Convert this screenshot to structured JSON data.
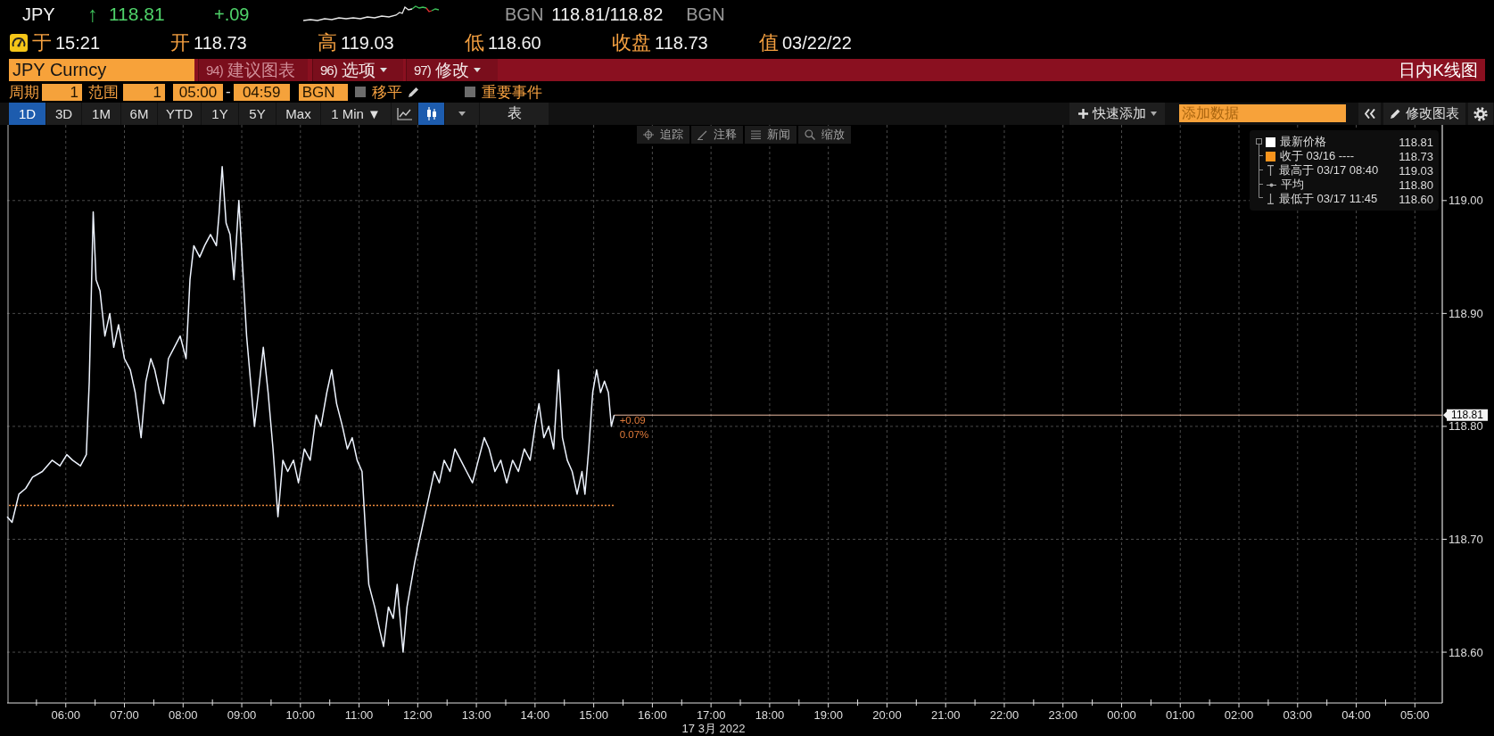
{
  "quote": {
    "ticker": "JPY",
    "arrow": "↑",
    "last": "118.81",
    "change": "+.09",
    "source": "BGN",
    "bid_ask": "118.81/118.82",
    "source_right": "BGN"
  },
  "stats": [
    {
      "label": "于",
      "value": "15:21"
    },
    {
      "label": "开",
      "value": "118.73"
    },
    {
      "label": "高",
      "value": "119.03"
    },
    {
      "label": "低",
      "value": "118.60"
    },
    {
      "label": "收盘",
      "value": "118.73"
    },
    {
      "label": "值",
      "value": "03/22/22"
    }
  ],
  "title_bar": {
    "security": "JPY Curncy",
    "menus": [
      {
        "number": "94)",
        "label": "建议图表",
        "disabled": true,
        "dropdown": false
      },
      {
        "number": "96)",
        "label": "选项",
        "disabled": false,
        "dropdown": true
      },
      {
        "number": "97)",
        "label": "修改",
        "disabled": false,
        "dropdown": true
      }
    ],
    "view_title": "日内K线图"
  },
  "settings": {
    "period_label": "周期",
    "period": "1",
    "range_label": "范围",
    "range": "1",
    "start": "05:00",
    "separator": "-",
    "end": "04:59",
    "source": "BGN",
    "checks": [
      {
        "label": "移平",
        "checked": false,
        "editable": true
      },
      {
        "label": "重要事件",
        "checked": false,
        "editable": false
      }
    ]
  },
  "toolbar": {
    "ranges": [
      {
        "label": "1D",
        "selected": true
      },
      {
        "label": "3D",
        "selected": false
      },
      {
        "label": "1M",
        "selected": false
      },
      {
        "label": "6M",
        "selected": false
      },
      {
        "label": "YTD",
        "selected": false
      },
      {
        "label": "1Y",
        "selected": false
      },
      {
        "label": "5Y",
        "selected": false
      },
      {
        "label": "Max",
        "selected": false
      }
    ],
    "interval": "1 Min ▼",
    "chart_types": [
      {
        "kind": "line",
        "selected": false
      },
      {
        "kind": "bar",
        "selected": true
      }
    ],
    "table": "表",
    "quick_add": "快速添加",
    "data_field": {
      "placeholder": "添加数据"
    },
    "edit_chart": "修改图表"
  },
  "chart": {
    "tools": [
      {
        "kind": "crosshair",
        "label": "追踪"
      },
      {
        "kind": "annotate",
        "label": "注释"
      },
      {
        "kind": "news",
        "label": "新闻"
      },
      {
        "kind": "zoom",
        "label": "缩放"
      }
    ],
    "legend": [
      {
        "kind": "swatch",
        "color": "#ffffff",
        "label": "最新价格",
        "value": "118.81"
      },
      {
        "kind": "swatch",
        "color": "#f7941d",
        "label": "收于 03/16 ----",
        "value": "118.73"
      },
      {
        "kind": "high",
        "label": "最高于 03/17 08:40",
        "value": "119.03"
      },
      {
        "kind": "average",
        "label": "平均",
        "value": "118.80"
      },
      {
        "kind": "low",
        "label": "最低于 03/17 11:45",
        "value": "118.60"
      }
    ],
    "chart_data": {
      "type": "line",
      "xlabel": "17 3月 2022",
      "grid": true,
      "x": [
        "2022-03-17T05:00",
        "2022-03-17T05:05",
        "2022-03-17T05:12",
        "2022-03-17T05:19",
        "2022-03-17T05:26",
        "2022-03-17T05:36",
        "2022-03-17T05:46",
        "2022-03-17T05:54",
        "2022-03-17T06:01",
        "2022-03-17T06:07",
        "2022-03-17T06:15",
        "2022-03-17T06:21",
        "2022-03-17T06:24",
        "2022-03-17T06:28",
        "2022-03-17T06:31",
        "2022-03-17T06:35",
        "2022-03-17T06:40",
        "2022-03-17T06:45",
        "2022-03-17T06:49",
        "2022-03-17T06:54",
        "2022-03-17T07:00",
        "2022-03-17T07:06",
        "2022-03-17T07:11",
        "2022-03-17T07:17",
        "2022-03-17T07:22",
        "2022-03-17T07:27",
        "2022-03-17T07:31",
        "2022-03-17T07:36",
        "2022-03-17T07:40",
        "2022-03-17T07:45",
        "2022-03-17T07:51",
        "2022-03-17T07:57",
        "2022-03-17T08:03",
        "2022-03-17T08:07",
        "2022-03-17T08:11",
        "2022-03-17T08:17",
        "2022-03-17T08:22",
        "2022-03-17T08:28",
        "2022-03-17T08:34",
        "2022-03-17T08:37",
        "2022-03-17T08:40",
        "2022-03-17T08:44",
        "2022-03-17T08:48",
        "2022-03-17T08:52",
        "2022-03-17T08:57",
        "2022-03-17T09:01",
        "2022-03-17T09:05",
        "2022-03-17T09:09",
        "2022-03-17T09:13",
        "2022-03-17T09:17",
        "2022-03-17T09:22",
        "2022-03-17T09:27",
        "2022-03-17T09:32",
        "2022-03-17T09:37",
        "2022-03-17T09:42",
        "2022-03-17T09:47",
        "2022-03-17T09:53",
        "2022-03-17T09:58",
        "2022-03-17T10:04",
        "2022-03-17T10:10",
        "2022-03-17T10:16",
        "2022-03-17T10:21",
        "2022-03-17T10:27",
        "2022-03-17T10:32",
        "2022-03-17T10:37",
        "2022-03-17T10:43",
        "2022-03-17T10:48",
        "2022-03-17T10:53",
        "2022-03-17T10:58",
        "2022-03-17T11:03",
        "2022-03-17T11:07",
        "2022-03-17T11:10",
        "2022-03-17T11:16",
        "2022-03-17T11:21",
        "2022-03-17T11:25",
        "2022-03-17T11:30",
        "2022-03-17T11:35",
        "2022-03-17T11:39",
        "2022-03-17T11:42",
        "2022-03-17T11:45",
        "2022-03-17T11:49",
        "2022-03-17T11:53",
        "2022-03-17T11:57",
        "2022-03-17T12:02",
        "2022-03-17T12:07",
        "2022-03-17T12:12",
        "2022-03-17T12:17",
        "2022-03-17T12:22",
        "2022-03-17T12:27",
        "2022-03-17T12:33",
        "2022-03-17T12:38",
        "2022-03-17T12:44",
        "2022-03-17T12:50",
        "2022-03-17T12:56",
        "2022-03-17T13:02",
        "2022-03-17T13:08",
        "2022-03-17T13:13",
        "2022-03-17T13:19",
        "2022-03-17T13:25",
        "2022-03-17T13:31",
        "2022-03-17T13:37",
        "2022-03-17T13:43",
        "2022-03-17T13:49",
        "2022-03-17T13:55",
        "2022-03-17T14:00",
        "2022-03-17T14:04",
        "2022-03-17T14:09",
        "2022-03-17T14:14",
        "2022-03-17T14:19",
        "2022-03-17T14:24",
        "2022-03-17T14:28",
        "2022-03-17T14:33",
        "2022-03-17T14:38",
        "2022-03-17T14:43",
        "2022-03-17T14:48",
        "2022-03-17T14:51",
        "2022-03-17T14:55",
        "2022-03-17T14:59",
        "2022-03-17T15:03",
        "2022-03-17T15:07",
        "2022-03-17T15:11",
        "2022-03-17T15:15",
        "2022-03-17T15:18",
        "2022-03-17T15:21"
      ],
      "values": [
        118.72,
        118.715,
        118.74,
        118.745,
        118.755,
        118.76,
        118.77,
        118.765,
        118.775,
        118.77,
        118.765,
        118.775,
        118.84,
        118.99,
        118.93,
        118.92,
        118.88,
        118.9,
        118.87,
        118.89,
        118.86,
        118.85,
        118.83,
        118.79,
        118.84,
        118.86,
        118.85,
        118.83,
        118.82,
        118.86,
        118.87,
        118.88,
        118.86,
        118.93,
        118.96,
        118.95,
        118.96,
        118.97,
        118.96,
        118.99,
        119.03,
        118.98,
        118.97,
        118.93,
        119.0,
        118.94,
        118.88,
        118.84,
        118.8,
        118.83,
        118.87,
        118.83,
        118.78,
        118.72,
        118.77,
        118.76,
        118.77,
        118.75,
        118.78,
        118.77,
        118.81,
        118.8,
        118.83,
        118.85,
        118.82,
        118.8,
        118.78,
        118.79,
        118.77,
        118.76,
        118.7,
        118.66,
        118.64,
        118.62,
        118.605,
        118.64,
        118.63,
        118.66,
        118.63,
        118.6,
        118.64,
        118.66,
        118.68,
        118.7,
        118.72,
        118.74,
        118.76,
        118.75,
        118.77,
        118.76,
        118.78,
        118.77,
        118.76,
        118.75,
        118.77,
        118.79,
        118.78,
        118.76,
        118.77,
        118.75,
        118.77,
        118.76,
        118.78,
        118.77,
        118.8,
        118.82,
        118.79,
        118.8,
        118.78,
        118.85,
        118.79,
        118.77,
        118.76,
        118.74,
        118.76,
        118.74,
        118.78,
        118.83,
        118.85,
        118.83,
        118.84,
        118.83,
        118.8,
        118.81
      ],
      "xlim": [
        "2022-03-17T05:00",
        "2022-03-18T05:28"
      ],
      "ylim": [
        118.555,
        119.067
      ],
      "xticks": [
        {
          "value": "2022-03-17T06:00",
          "label": "06:00"
        },
        {
          "value": "2022-03-17T07:00",
          "label": "07:00"
        },
        {
          "value": "2022-03-17T08:00",
          "label": "08:00"
        },
        {
          "value": "2022-03-17T09:00",
          "label": "09:00"
        },
        {
          "value": "2022-03-17T10:00",
          "label": "10:00"
        },
        {
          "value": "2022-03-17T11:00",
          "label": "11:00"
        },
        {
          "value": "2022-03-17T12:00",
          "label": "12:00"
        },
        {
          "value": "2022-03-17T13:00",
          "label": "13:00"
        },
        {
          "value": "2022-03-17T14:00",
          "label": "14:00"
        },
        {
          "value": "2022-03-17T15:00",
          "label": "15:00"
        },
        {
          "value": "2022-03-17T16:00",
          "label": "16:00"
        },
        {
          "value": "2022-03-17T17:00",
          "label": "17:00"
        },
        {
          "value": "2022-03-17T18:00",
          "label": "18:00"
        },
        {
          "value": "2022-03-17T19:00",
          "label": "19:00"
        },
        {
          "value": "2022-03-17T20:00",
          "label": "20:00"
        },
        {
          "value": "2022-03-17T21:00",
          "label": "21:00"
        },
        {
          "value": "2022-03-17T22:00",
          "label": "22:00"
        },
        {
          "value": "2022-03-17T23:00",
          "label": "23:00"
        },
        {
          "value": "2022-03-18T00:00",
          "label": "00:00"
        },
        {
          "value": "2022-03-18T01:00",
          "label": "01:00"
        },
        {
          "value": "2022-03-18T02:00",
          "label": "02:00"
        },
        {
          "value": "2022-03-18T03:00",
          "label": "03:00"
        },
        {
          "value": "2022-03-18T04:00",
          "label": "04:00"
        },
        {
          "value": "2022-03-18T05:00",
          "label": "05:00"
        }
      ],
      "yticks": [
        {
          "value": 118.6,
          "label": "118.60"
        },
        {
          "value": 118.7,
          "label": "118.70"
        },
        {
          "value": 118.8,
          "label": "118.80"
        },
        {
          "value": 118.9,
          "label": "118.90"
        },
        {
          "value": 119.0,
          "label": "119.00"
        }
      ],
      "ref_lines": [
        {
          "axis": "y",
          "value": 118.81,
          "label": "118.81",
          "color": "#e9b9a0"
        },
        {
          "axis": "y",
          "value": 118.73,
          "color": "#f08a3c"
        }
      ],
      "annotations": [
        "+0.09",
        "0.07%"
      ]
    }
  }
}
